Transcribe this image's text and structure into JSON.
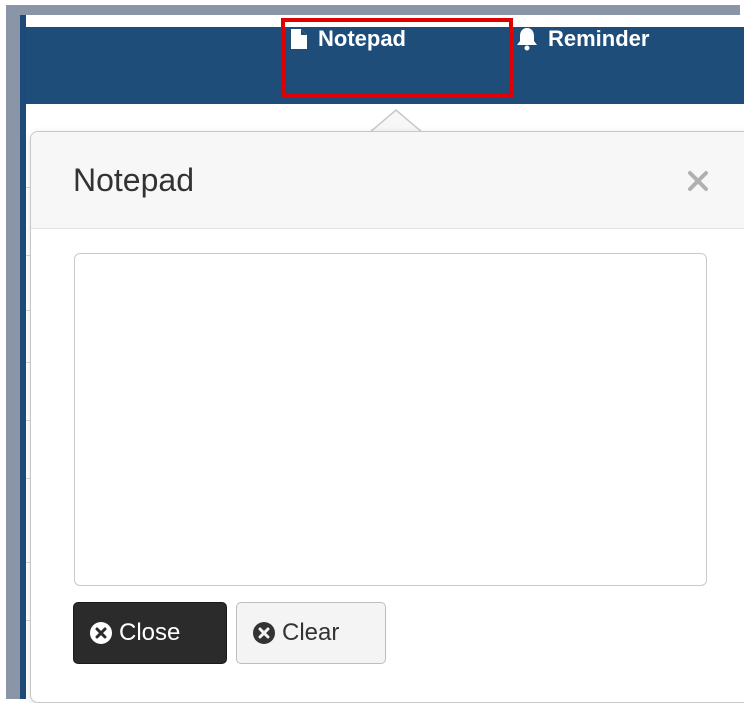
{
  "navbar": {
    "items": [
      {
        "label": "Notepad",
        "icon": "file-icon"
      },
      {
        "label": "Reminder",
        "icon": "bell-icon"
      }
    ],
    "highlight_color": "#e00000",
    "background": "#1e4d7a"
  },
  "popover": {
    "title": "Notepad",
    "close_glyph": "×",
    "notes_value": "",
    "buttons": {
      "close_label": "Close",
      "clear_label": "Clear"
    }
  }
}
